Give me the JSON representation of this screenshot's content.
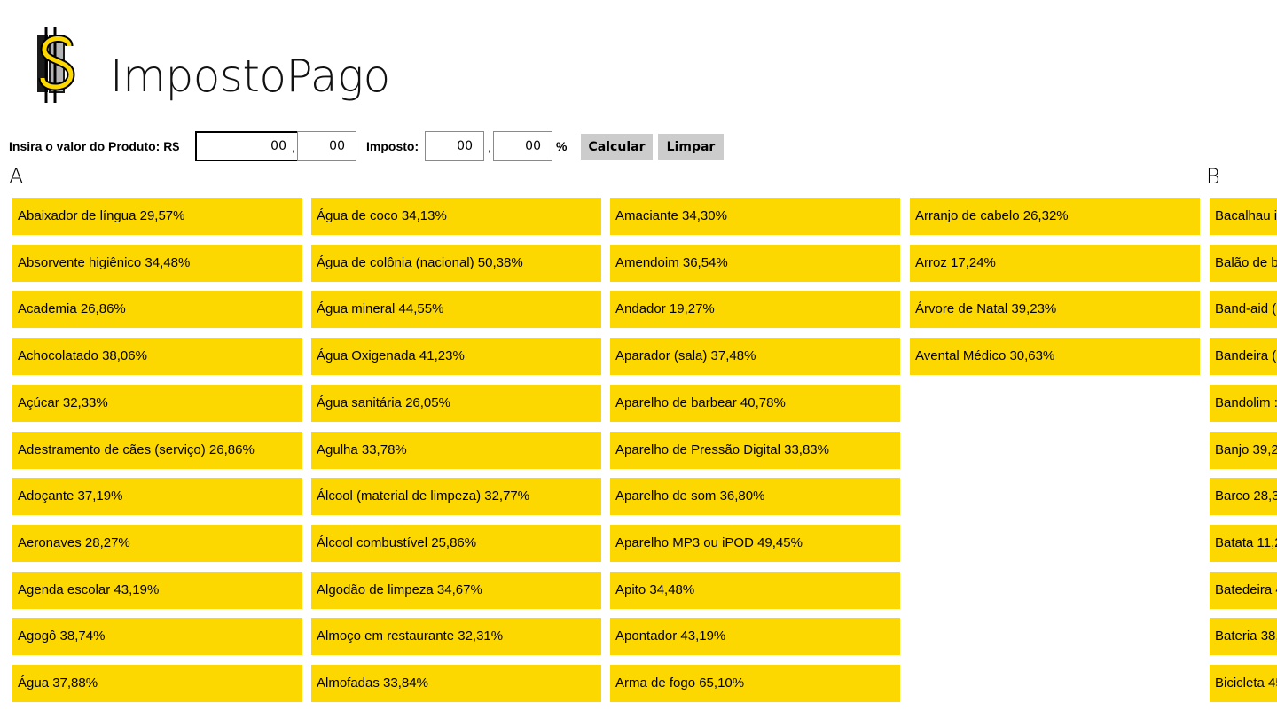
{
  "app": {
    "title": "ImpostoPago"
  },
  "calculator": {
    "product_label": "Insira o valor do Produto: R$",
    "product_int": "00",
    "product_dec": "00",
    "comma": ",",
    "tax_label": "Imposto:",
    "tax_int": "00",
    "tax_dec": "00",
    "percent": "%",
    "calc_label": "Calcular",
    "clear_label": "Limpar"
  },
  "groups": [
    {
      "letter": "A",
      "items": [
        "Abaixador de língua 29,57%",
        "Absorvente higiênico 34,48%",
        "Academia 26,86%",
        "Achocolatado 38,06%",
        "Açúcar 32,33%",
        "Adestramento de cães (serviço) 26,86%",
        "Adoçante 37,19%",
        "Aeronaves 28,27%",
        "Agenda escolar 43,19%",
        "Agogô 38,74%",
        "Água 37,88%",
        "Água de coco 34,13%",
        "Água de colônia (nacional) 50,38%",
        "Água mineral 44,55%",
        "Água Oxigenada 41,23%",
        "Água sanitária 26,05%",
        "Agulha 33,78%",
        "Álcool (material de limpeza) 32,77%",
        "Álcool combustível 25,86%",
        "Algodão de limpeza 34,67%",
        "Almoço em restaurante 32,31%",
        "Almofadas 33,84%",
        "Amaciante 34,30%",
        "Amendoim 36,54%",
        "Andador 19,27%",
        "Aparador (sala) 37,48%",
        "Aparelho de barbear 40,78%",
        "Aparelho de Pressão Digital 33,83%",
        "Aparelho de som 36,80%",
        "Aparelho MP3 ou iPOD 49,45%",
        "Apito 34,48%",
        "Apontador 43,19%",
        "Arma de fogo 65,10%",
        "Arranjo de cabelo 26,32%",
        "Arroz 17,24%",
        "Árvore de Natal 39,23%",
        "Avental Médico 30,63%"
      ]
    },
    {
      "letter": "B",
      "items": [
        "Bacalhau i",
        "Balão de b",
        "Band-aid (",
        "Bandeira (",
        "Bandolim :",
        "Banjo 39,2",
        "Barco 28,3",
        "Batata 11,2",
        "Batedeira 4",
        "Bateria 38,",
        "Bicicleta 45"
      ]
    }
  ]
}
